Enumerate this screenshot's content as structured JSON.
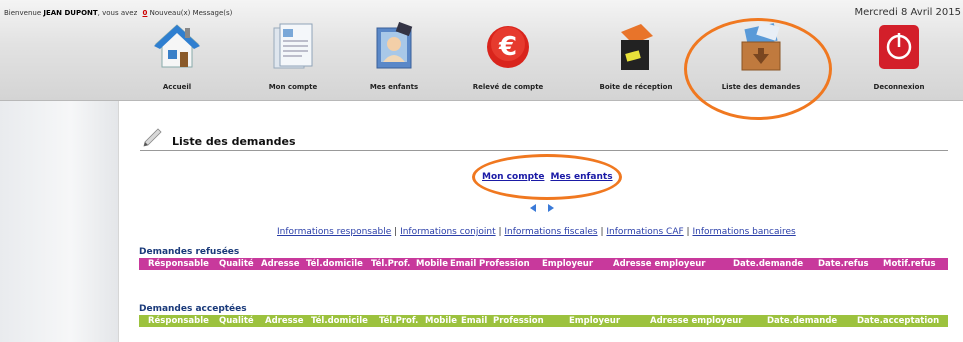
{
  "header": {
    "welcome_prefix": "Bienvenue",
    "user_name": "JEAN DUPONT",
    "welcome_mid": ", vous avez",
    "message_count": "0",
    "message_label": "Nouveau(x) Message(s)",
    "date": "Mercredi 8 Avril 2015"
  },
  "nav": [
    {
      "label": "Accueil",
      "icon": "house-icon"
    },
    {
      "label": "Mon compte",
      "icon": "document-icon"
    },
    {
      "label": "Mes enfants",
      "icon": "photo-icon"
    },
    {
      "label": "Relevé de compte",
      "icon": "euro-icon"
    },
    {
      "label": "Boite de réception",
      "icon": "inbox-icon"
    },
    {
      "label": "Liste des demandes",
      "icon": "box-download-icon"
    },
    {
      "label": "Deconnexion",
      "icon": "power-icon"
    }
  ],
  "page": {
    "title": "Liste des demandes",
    "links": {
      "mon_compte": "Mon compte",
      "mes_enfants": "Mes enfants"
    },
    "info_links": [
      "Informations responsable",
      "Informations conjoint",
      "Informations fiscales",
      "Informations CAF",
      "Informations bancaires"
    ],
    "separator": "|"
  },
  "refused": {
    "title": "Demandes refusées",
    "columns": [
      "Résponsable",
      "Qualité",
      "Adresse",
      "Tél.domicile",
      "Tél.Prof.",
      "Mobile",
      "Email",
      "Profession",
      "Employeur",
      "Adresse employeur",
      "Date.demande",
      "Date.refus",
      "Motif.refus"
    ]
  },
  "accepted": {
    "title": "Demandes acceptées",
    "columns": [
      "Résponsable",
      "Qualité",
      "Adresse",
      "Tél.domicile",
      "Tél.Prof.",
      "Mobile",
      "Email",
      "Profession",
      "Employeur",
      "Adresse employeur",
      "Date.demande",
      "Date.acceptation"
    ]
  },
  "colors": {
    "refused_header": "#c8399c",
    "accepted_header": "#9cc23e",
    "highlight": "#f07820"
  }
}
